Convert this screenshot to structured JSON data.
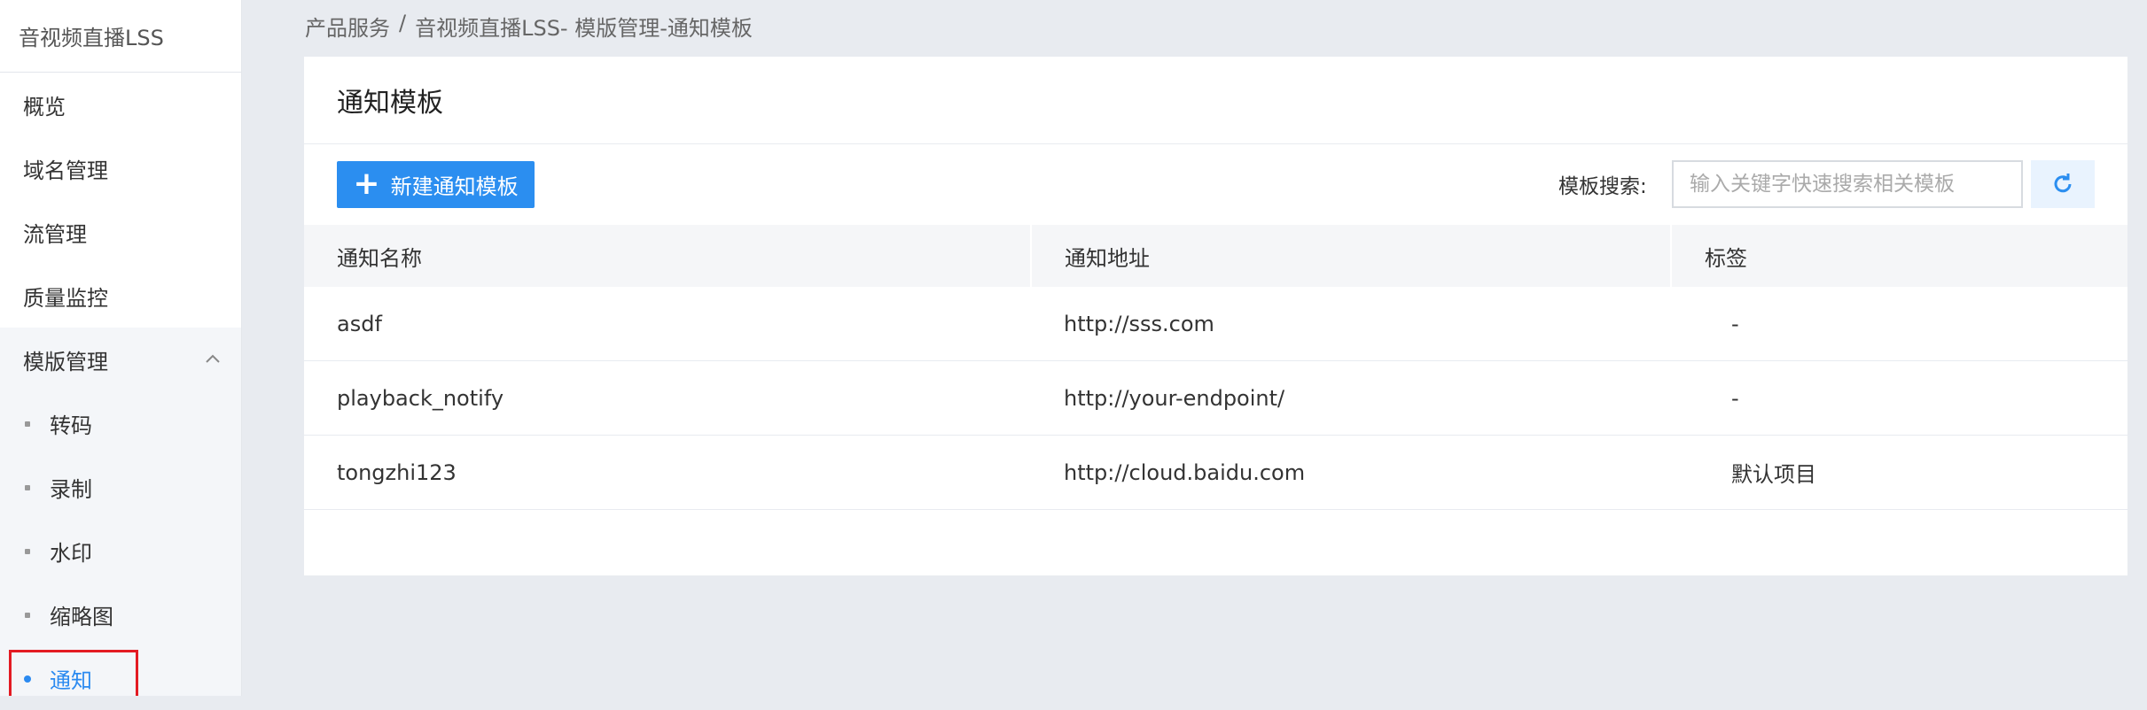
{
  "sidebar": {
    "title": "音视频直播LSS",
    "items": [
      "概览",
      "域名管理",
      "流管理",
      "质量监控"
    ],
    "group_label": "模版管理",
    "sub_items": [
      "转码",
      "录制",
      "水印",
      "缩略图",
      "通知"
    ],
    "active_sub": "通知"
  },
  "breadcrumb": {
    "root": "产品服务",
    "sep": "/",
    "current": "音视频直播LSS- 模版管理-通知模板"
  },
  "card": {
    "title": "通知模板"
  },
  "toolbar": {
    "new_button": "新建通知模板",
    "search_label": "模板搜索:",
    "search_placeholder": "输入关键字快速搜索相关模板"
  },
  "table": {
    "headers": [
      "通知名称",
      "通知地址",
      "标签"
    ],
    "rows": [
      [
        "asdf",
        "http://sss.com",
        "-"
      ],
      [
        "playback_notify",
        "http://your-endpoint/",
        "-"
      ],
      [
        "tongzhi123",
        "http://cloud.baidu.com",
        "默认项目"
      ]
    ]
  },
  "colors": {
    "accent": "#2b8ef0",
    "highlight": "#e31b23"
  }
}
